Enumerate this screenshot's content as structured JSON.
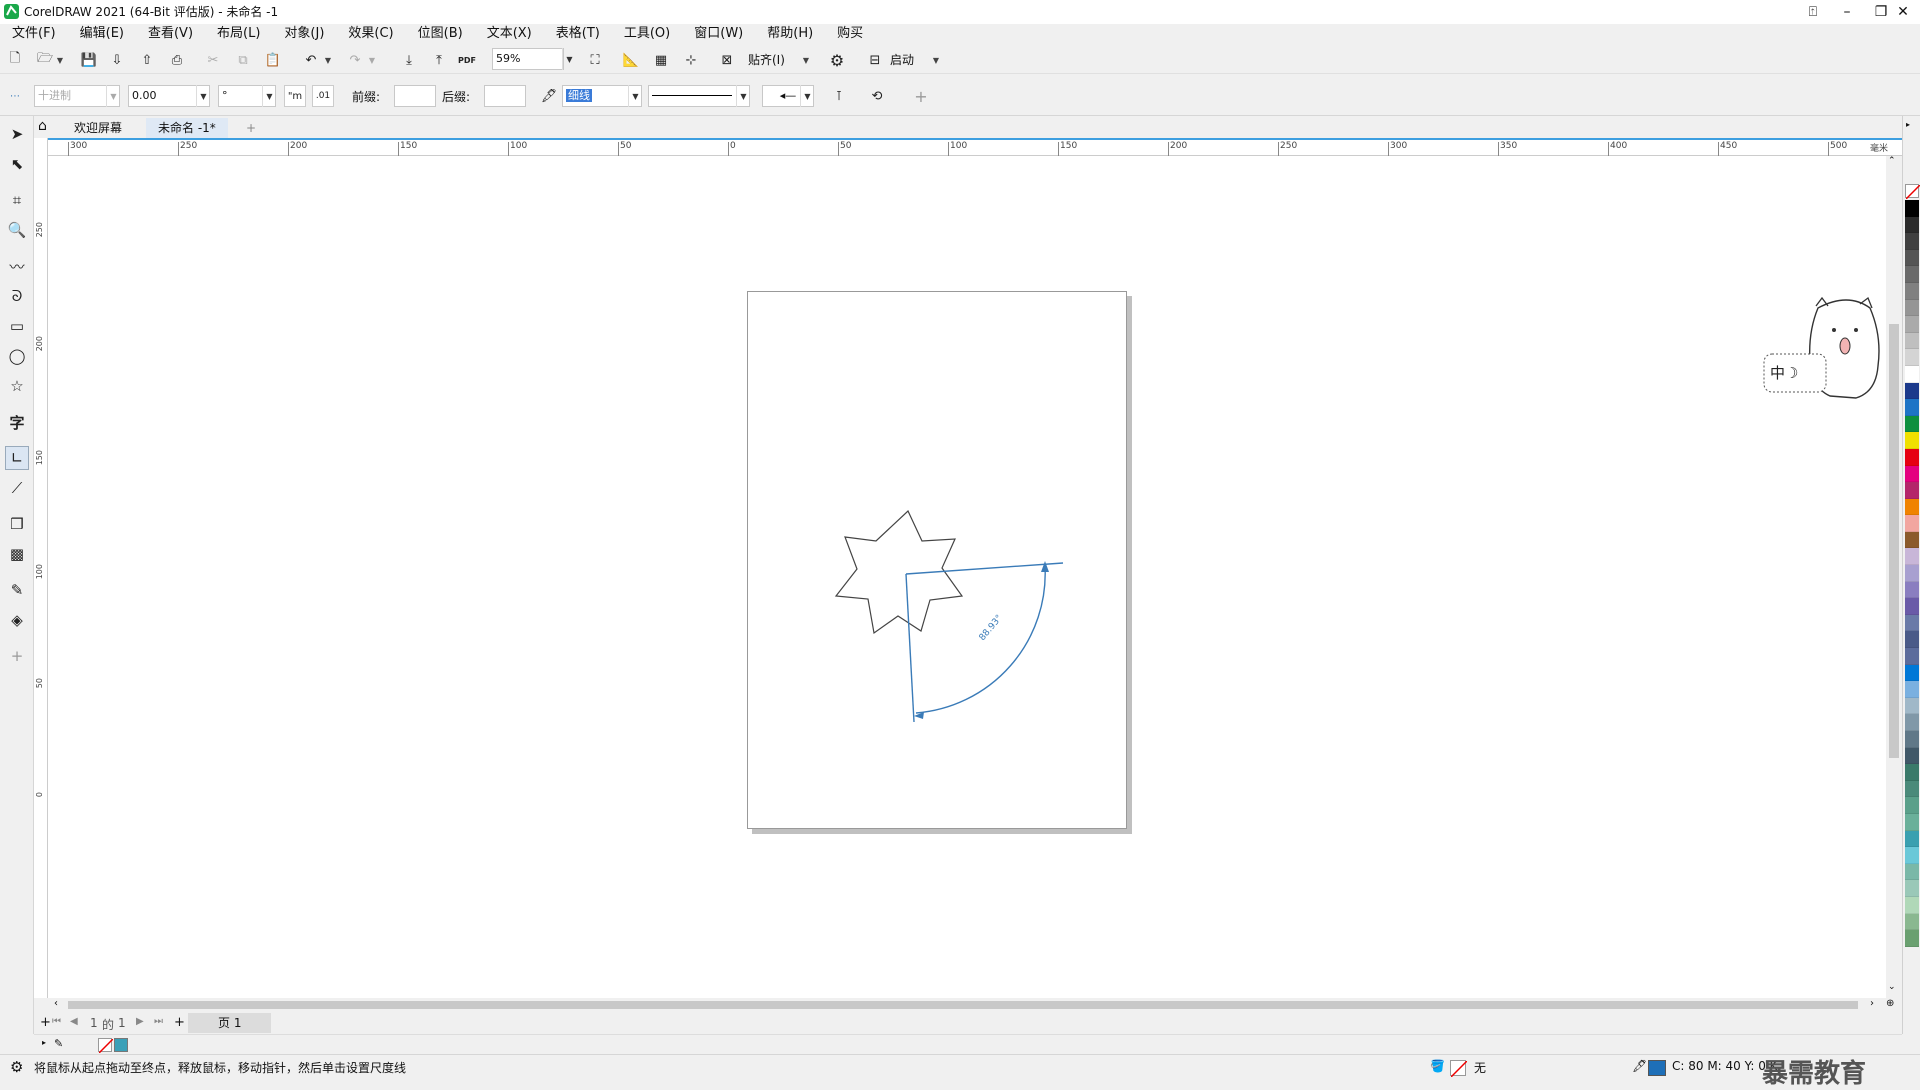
{
  "titlebar": {
    "title": "CorelDRAW 2021 (64-Bit 评估版) - 未命名 -1"
  },
  "menu": [
    "文件(F)",
    "编辑(E)",
    "查看(V)",
    "布局(L)",
    "对象(J)",
    "效果(C)",
    "位图(B)",
    "文本(X)",
    "表格(T)",
    "工具(O)",
    "窗口(W)",
    "帮助(H)",
    "购买"
  ],
  "toolbar": {
    "zoom": "59%",
    "snap_label": "贴齐(I)",
    "launch_label": "启动"
  },
  "propbar": {
    "units_value": "十进制",
    "precision_value": "0.00",
    "angle_unit": "°",
    "prefix_label": "前缀:",
    "prefix_value": "",
    "suffix_label": "后缀:",
    "suffix_value": "",
    "outline_width": "细线"
  },
  "tabs": {
    "welcome": "欢迎屏幕",
    "document": "未命名 -1*"
  },
  "hruler": {
    "labels": [
      "300",
      "250",
      "200",
      "150",
      "100",
      "50",
      "0",
      "50",
      "100",
      "150",
      "200",
      "250",
      "300",
      "350",
      "400",
      "450",
      "500"
    ],
    "unit": "毫米"
  },
  "vruler": {
    "labels": [
      "250",
      "200",
      "150",
      "100",
      "50",
      "0"
    ]
  },
  "drawing": {
    "angle_label": "88.93°",
    "accent": "#3a7bb8"
  },
  "pagenav": {
    "current": "1",
    "of": "的",
    "total": "1",
    "page_tab": "页 1"
  },
  "status": {
    "hint": "将鼠标从起点拖动至终点，释放鼠标，移动指针，然后单击设置尺度线",
    "fill_value": "无",
    "outline_color": "C: 80 M: 40 Y: 0 K:",
    "watermark": "暴需教育"
  },
  "palette": {
    "colors": [
      "#000000",
      "#2b2b2b",
      "#404040",
      "#555555",
      "#6a6a6a",
      "#808080",
      "#959595",
      "#aaaaaa",
      "#bfbfbf",
      "#d4d4d4",
      "#ffffff",
      "#1c3a8c",
      "#1e74c6",
      "#0e8f3e",
      "#f0e000",
      "#e60012",
      "#e4007f",
      "#b4256a",
      "#f08300",
      "#f2a6a0",
      "#8b5a2b",
      "#c8b6d8",
      "#a8a0d0",
      "#8a7ec0",
      "#6a5aa8",
      "#6a7aa8",
      "#4a5a88",
      "#5c6c9c",
      "#0078d7",
      "#7ab0e0",
      "#a0b8c8",
      "#8098a8",
      "#607888",
      "#405868",
      "#3a7a6a",
      "#4a8a7a",
      "#5aa08a",
      "#6ab09a",
      "#3aa0b0",
      "#6ac8d8",
      "#7ab8a8",
      "#9ac8b8",
      "#b0d8b8",
      "#8ab890",
      "#6aa070"
    ]
  }
}
